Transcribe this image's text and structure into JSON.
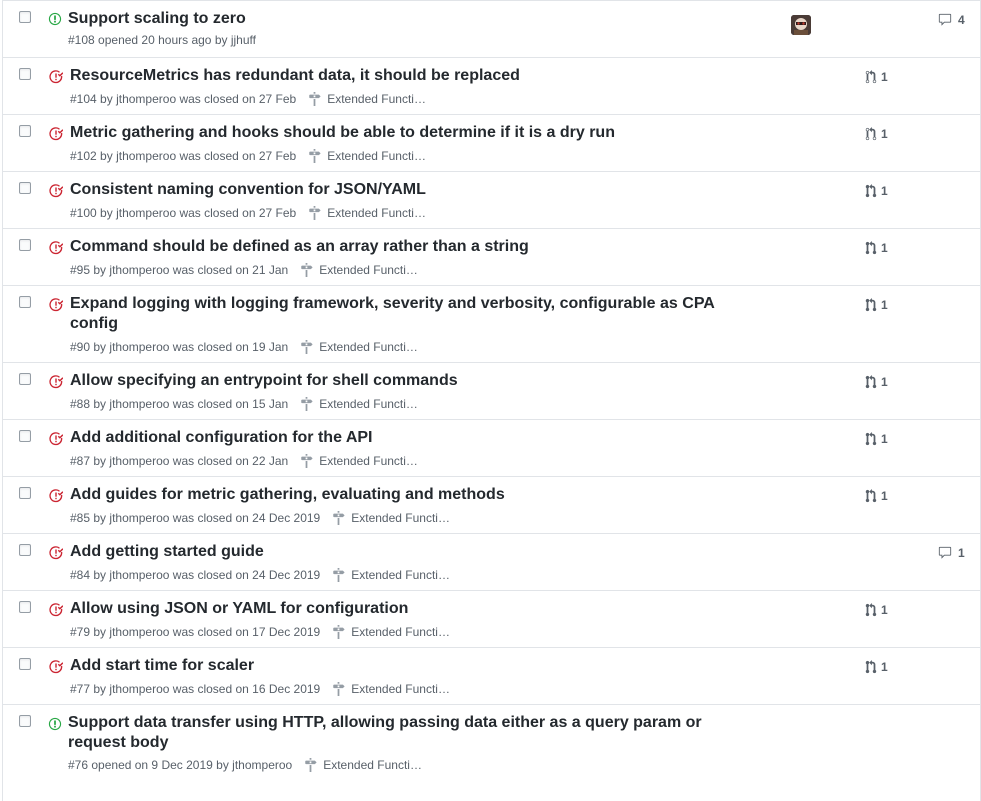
{
  "colors": {
    "open": "#28a745",
    "closed": "#cb2431",
    "muted": "#586069"
  },
  "issues": [
    {
      "number": "#108",
      "title": "Support scaling to zero",
      "state": "open",
      "meta": "opened 20 hours ago by",
      "author": "jjhuff",
      "milestone": "",
      "linked_prs": "",
      "comments": "4",
      "assignee_icon": "avatar"
    },
    {
      "number": "#104",
      "title": "ResourceMetrics has redundant data, it should be replaced",
      "state": "closed",
      "meta_pre": "by",
      "author": "jthomperoo",
      "meta": "was closed on 27 Feb",
      "milestone": "Extended Functi…",
      "linked_prs": "1"
    },
    {
      "number": "#102",
      "title": "Metric gathering and hooks should be able to determine if it is a dry run",
      "state": "closed",
      "meta_pre": "by",
      "author": "jthomperoo",
      "meta": "was closed on 27 Feb",
      "milestone": "Extended Functi…",
      "linked_prs": "1"
    },
    {
      "number": "#100",
      "title": "Consistent naming convention for JSON/YAML",
      "state": "closed",
      "meta_pre": "by",
      "author": "jthomperoo",
      "meta": "was closed on 27 Feb",
      "milestone": "Extended Functi…",
      "linked_prs": "1"
    },
    {
      "number": "#95",
      "title": "Command should be defined as an array rather than a string",
      "state": "closed",
      "meta_pre": "by",
      "author": "jthomperoo",
      "meta": "was closed on 21 Jan",
      "milestone": "Extended Functi…",
      "linked_prs": "1"
    },
    {
      "number": "#90",
      "title_line1": "Expand logging with logging framework, severity and verbosity, configurable as CPA",
      "title_line2": "config",
      "state": "closed",
      "meta_pre": "by",
      "author": "jthomperoo",
      "meta": "was closed on 19 Jan",
      "milestone": "Extended Functi…",
      "linked_prs": "1"
    },
    {
      "number": "#88",
      "title": "Allow specifying an entrypoint for shell commands",
      "state": "closed",
      "meta_pre": "by",
      "author": "jthomperoo",
      "meta": "was closed on 15 Jan",
      "milestone": "Extended Functi…",
      "linked_prs": "1"
    },
    {
      "number": "#87",
      "title": "Add additional configuration for the API",
      "state": "closed",
      "meta_pre": "by",
      "author": "jthomperoo",
      "meta": "was closed on 22 Jan",
      "milestone": "Extended Functi…",
      "linked_prs": "1"
    },
    {
      "number": "#85",
      "title": "Add guides for metric gathering, evaluating and methods",
      "state": "closed",
      "meta_pre": "by",
      "author": "jthomperoo",
      "meta": "was closed on 24 Dec 2019",
      "milestone": "Extended Functi…",
      "linked_prs": "1"
    },
    {
      "number": "#84",
      "title": "Add getting started guide",
      "state": "closed",
      "meta_pre": "by",
      "author": "jthomperoo",
      "meta": "was closed on 24 Dec 2019",
      "milestone": "Extended Functi…",
      "linked_prs": "",
      "comments": "1"
    },
    {
      "number": "#79",
      "title": "Allow using JSON or YAML for configuration",
      "state": "closed",
      "meta_pre": "by",
      "author": "jthomperoo",
      "meta": "was closed on 17 Dec 2019",
      "milestone": "Extended Functi…",
      "linked_prs": "1"
    },
    {
      "number": "#77",
      "title": "Add start time for scaler",
      "state": "closed",
      "meta_pre": "by",
      "author": "jthomperoo",
      "meta": "was closed on 16 Dec 2019",
      "milestone": "Extended Functi…",
      "linked_prs": "1"
    },
    {
      "number": "#76",
      "title_line1": "Support data transfer using HTTP, allowing passing data either as a query param or",
      "title_line2": "request body",
      "state": "open",
      "meta": "opened on 9 Dec 2019 by",
      "author": "jthomperoo",
      "milestone": "Extended Functi…",
      "linked_prs": ""
    }
  ]
}
